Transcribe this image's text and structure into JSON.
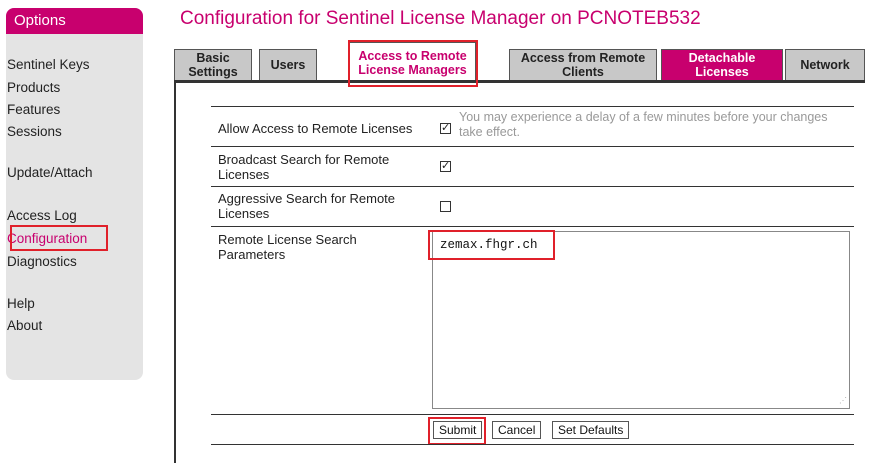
{
  "sidebar": {
    "title": "Options",
    "items": [
      {
        "label": "Sentinel Keys"
      },
      {
        "label": "Products"
      },
      {
        "label": "Features"
      },
      {
        "label": "Sessions"
      },
      {
        "label": "Update/Attach"
      },
      {
        "label": "Access Log"
      },
      {
        "label": "Configuration"
      },
      {
        "label": "Diagnostics"
      },
      {
        "label": "Help"
      },
      {
        "label": "About"
      }
    ],
    "active_item": "Configuration"
  },
  "page": {
    "title": "Configuration for Sentinel License Manager on PCNOTEB532"
  },
  "tabs": [
    {
      "label": "Basic Settings"
    },
    {
      "label": "Users"
    },
    {
      "label": "Access to Remote License Managers"
    },
    {
      "label": "Access from Remote Clients"
    },
    {
      "label": "Detachable Licenses"
    },
    {
      "label": "Network"
    }
  ],
  "active_tab": "Access to Remote License Managers",
  "form": {
    "allow_access": {
      "label": "Allow Access to Remote Licenses",
      "checked": true,
      "hint": "You may experience a delay of a few minutes before your changes take effect."
    },
    "broadcast_search": {
      "label": "Broadcast Search for Remote Licenses",
      "checked": true
    },
    "aggressive_search": {
      "label": "Aggressive Search for Remote Licenses",
      "checked": false
    },
    "search_params": {
      "label": "Remote License Search Parameters",
      "value": "zemax.fhgr.ch"
    }
  },
  "buttons": {
    "submit": "Submit",
    "cancel": "Cancel",
    "set_defaults": "Set Defaults"
  },
  "colors": {
    "brand": "#c8006e",
    "highlight": "#e0202a",
    "sidebar_bg": "#e4e4e4",
    "tab_bg": "#c8c8c8"
  }
}
